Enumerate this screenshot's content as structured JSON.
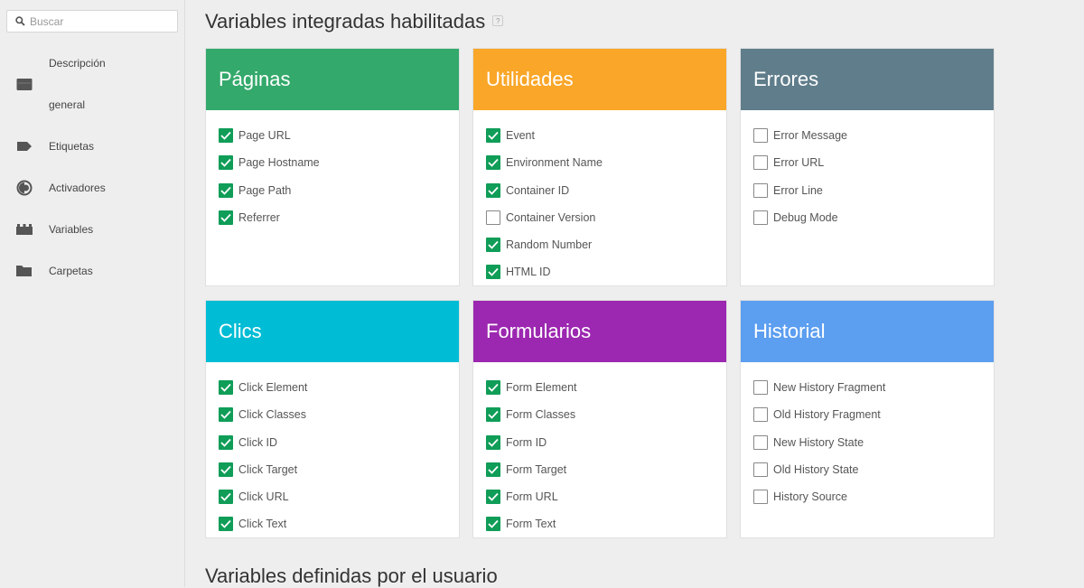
{
  "search": {
    "placeholder": "Buscar"
  },
  "sidebar": {
    "items": [
      {
        "label_line1": "Descripción",
        "label_line2": "general",
        "icon": "overview-icon"
      },
      {
        "label": "Etiquetas",
        "icon": "tag-icon"
      },
      {
        "label": "Activadores",
        "icon": "trigger-icon"
      },
      {
        "label": "Variables",
        "icon": "variables-icon"
      },
      {
        "label": "Carpetas",
        "icon": "folder-icon"
      }
    ]
  },
  "main": {
    "builtin_title": "Variables integradas habilitadas",
    "builtin_help": "?",
    "user_title": "Variables definidas por el usuario",
    "cards": [
      {
        "title": "Páginas",
        "color": "#33a96b",
        "items": [
          {
            "label": "Page URL",
            "checked": true
          },
          {
            "label": "Page Hostname",
            "checked": true
          },
          {
            "label": "Page Path",
            "checked": true
          },
          {
            "label": "Referrer",
            "checked": true
          }
        ]
      },
      {
        "title": "Utilidades",
        "color": "#faa628",
        "items": [
          {
            "label": "Event",
            "checked": true
          },
          {
            "label": "Environment Name",
            "checked": true
          },
          {
            "label": "Container ID",
            "checked": true
          },
          {
            "label": "Container Version",
            "checked": false
          },
          {
            "label": "Random Number",
            "checked": true
          },
          {
            "label": "HTML ID",
            "checked": true
          }
        ]
      },
      {
        "title": "Errores",
        "color": "#607d8b",
        "items": [
          {
            "label": "Error Message",
            "checked": false
          },
          {
            "label": "Error URL",
            "checked": false
          },
          {
            "label": "Error Line",
            "checked": false
          },
          {
            "label": "Debug Mode",
            "checked": false
          }
        ]
      },
      {
        "title": "Clics",
        "color": "#00bcd4",
        "items": [
          {
            "label": "Click Element",
            "checked": true
          },
          {
            "label": "Click Classes",
            "checked": true
          },
          {
            "label": "Click ID",
            "checked": true
          },
          {
            "label": "Click Target",
            "checked": true
          },
          {
            "label": "Click URL",
            "checked": true
          },
          {
            "label": "Click Text",
            "checked": true
          }
        ]
      },
      {
        "title": "Formularios",
        "color": "#9c27b0",
        "items": [
          {
            "label": "Form Element",
            "checked": true
          },
          {
            "label": "Form Classes",
            "checked": true
          },
          {
            "label": "Form ID",
            "checked": true
          },
          {
            "label": "Form Target",
            "checked": true
          },
          {
            "label": "Form URL",
            "checked": true
          },
          {
            "label": "Form Text",
            "checked": true
          }
        ]
      },
      {
        "title": "Historial",
        "color": "#5c9ef0",
        "items": [
          {
            "label": "New History Fragment",
            "checked": false
          },
          {
            "label": "Old History Fragment",
            "checked": false
          },
          {
            "label": "New History State",
            "checked": false
          },
          {
            "label": "Old History State",
            "checked": false
          },
          {
            "label": "History Source",
            "checked": false
          }
        ]
      }
    ]
  }
}
